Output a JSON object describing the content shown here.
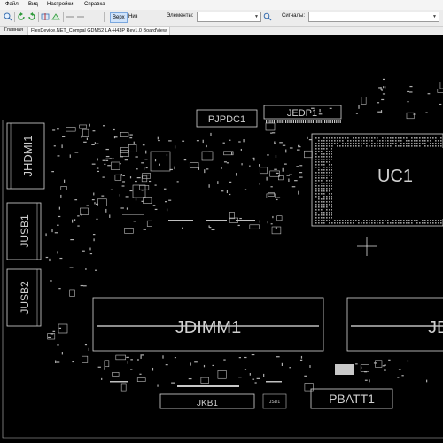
{
  "menu": {
    "file": "Файл",
    "view": "Вид",
    "settings": "Настройки",
    "help": "Справка"
  },
  "toolbar": {
    "side_top": "Верх",
    "side_bottom": "Низ",
    "elements_label": "Элементы:",
    "elements_value": "",
    "nets_label": "Сигналы:",
    "nets_value": ""
  },
  "tabs": {
    "main": "Главная",
    "document": "FlexDevice.NET_Compal GDM52 LA-H43P Rev1.0 BoardView"
  },
  "board": {
    "components": {
      "jhdmi1": "JHDMI1",
      "jusb1": "JUSB1",
      "jusb2": "JUSB2",
      "pjpdc1": "PJPDC1",
      "jedp1": "JEDP1",
      "uc1": "UC1",
      "jdimm1": "JDIMM1",
      "jdimm2_partial": "JD",
      "jkb1": "JKB1",
      "pbatt1": "PBATT1",
      "jsd1": "JSD1"
    }
  }
}
